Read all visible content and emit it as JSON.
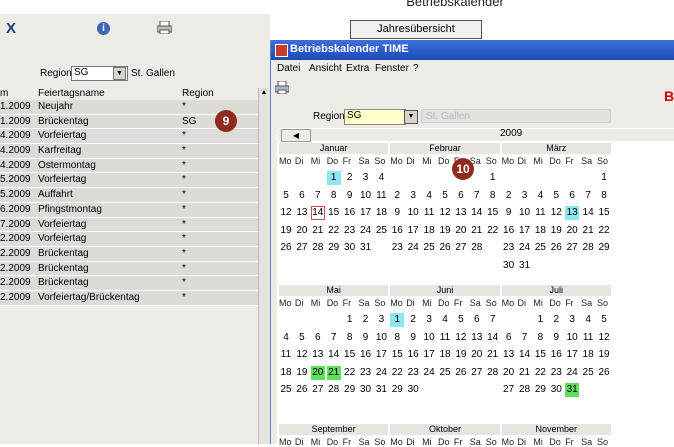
{
  "header": {
    "top_title": "Betriebskalender",
    "year_button": "Jahresübersicht"
  },
  "toolbar": {
    "close_icon": "X"
  },
  "left": {
    "region_label": "Region",
    "region_value": "SG",
    "region_name": "St. Gallen",
    "headers": [
      "m",
      "Feiertagsname",
      "Region"
    ],
    "rows": [
      {
        "date": "1.2009",
        "name": "Neujahr",
        "region": "*"
      },
      {
        "date": "1.2009",
        "name": "Brückentag",
        "region": "SG"
      },
      {
        "date": "4.2009",
        "name": "Vorfeiertag",
        "region": "*"
      },
      {
        "date": "4.2009",
        "name": "Karfreitag",
        "region": "*"
      },
      {
        "date": "4.2009",
        "name": "Ostermontag",
        "region": "*"
      },
      {
        "date": "5.2009",
        "name": "Vorfeiertag",
        "region": "*"
      },
      {
        "date": "5.2009",
        "name": "Auffahrt",
        "region": "*"
      },
      {
        "date": "6.2009",
        "name": "Pfingstmontag",
        "region": "*"
      },
      {
        "date": "7.2009",
        "name": "Vorfeiertag",
        "region": "*"
      },
      {
        "date": "2.2009",
        "name": "Vorfeiertag",
        "region": "*"
      },
      {
        "date": "2.2009",
        "name": "Brückentag",
        "region": "*"
      },
      {
        "date": "2.2009",
        "name": "Brückentag",
        "region": "*"
      },
      {
        "date": "2.2009",
        "name": "Brückentag",
        "region": "*"
      },
      {
        "date": "2.2009",
        "name": "Vorfeiertag/Brückentag",
        "region": "*"
      }
    ]
  },
  "badges": {
    "b9": "9",
    "b10": "10"
  },
  "calendar_window": {
    "title": "Betriebskalender TIME",
    "menu": [
      "Datei",
      "Ansicht",
      "Extra",
      "Fenster",
      "?"
    ],
    "region_label": "Region",
    "region_value": "SG",
    "region_name": "St. Gallen",
    "year": "2009",
    "red_letter": "B",
    "weekdays": [
      "Mo",
      "Di",
      "Mi",
      "Do",
      "Fr",
      "Sa",
      "So"
    ],
    "colors": {
      "cyan": "#8ee6f0",
      "green": "#5fe05a"
    },
    "months": [
      {
        "name": "Januar",
        "lead": 3,
        "days": 31,
        "cyan": [
          1
        ],
        "green": [],
        "boxed": [
          14
        ]
      },
      {
        "name": "Februar",
        "lead": 6,
        "days": 28,
        "cyan": [],
        "green": [],
        "boxed": []
      },
      {
        "name": "März",
        "lead": 6,
        "days": 31,
        "cyan": [
          13
        ],
        "green": [],
        "boxed": []
      },
      {
        "name": "Mai",
        "lead": 4,
        "days": 31,
        "cyan": [],
        "green": [
          20,
          21
        ],
        "boxed": []
      },
      {
        "name": "Juni",
        "lead": 0,
        "days": 30,
        "cyan": [
          1
        ],
        "green": [],
        "boxed": []
      },
      {
        "name": "Juli",
        "lead": 2,
        "days": 31,
        "cyan": [],
        "green": [
          31
        ],
        "boxed": []
      },
      {
        "name": "September",
        "lead": 1,
        "days": 30,
        "cyan": [],
        "green": [],
        "boxed": []
      },
      {
        "name": "Oktober",
        "lead": 3,
        "days": 31,
        "cyan": [],
        "green": [],
        "boxed": []
      },
      {
        "name": "November",
        "lead": 6,
        "days": 30,
        "cyan": [],
        "green": [],
        "boxed": []
      }
    ]
  }
}
